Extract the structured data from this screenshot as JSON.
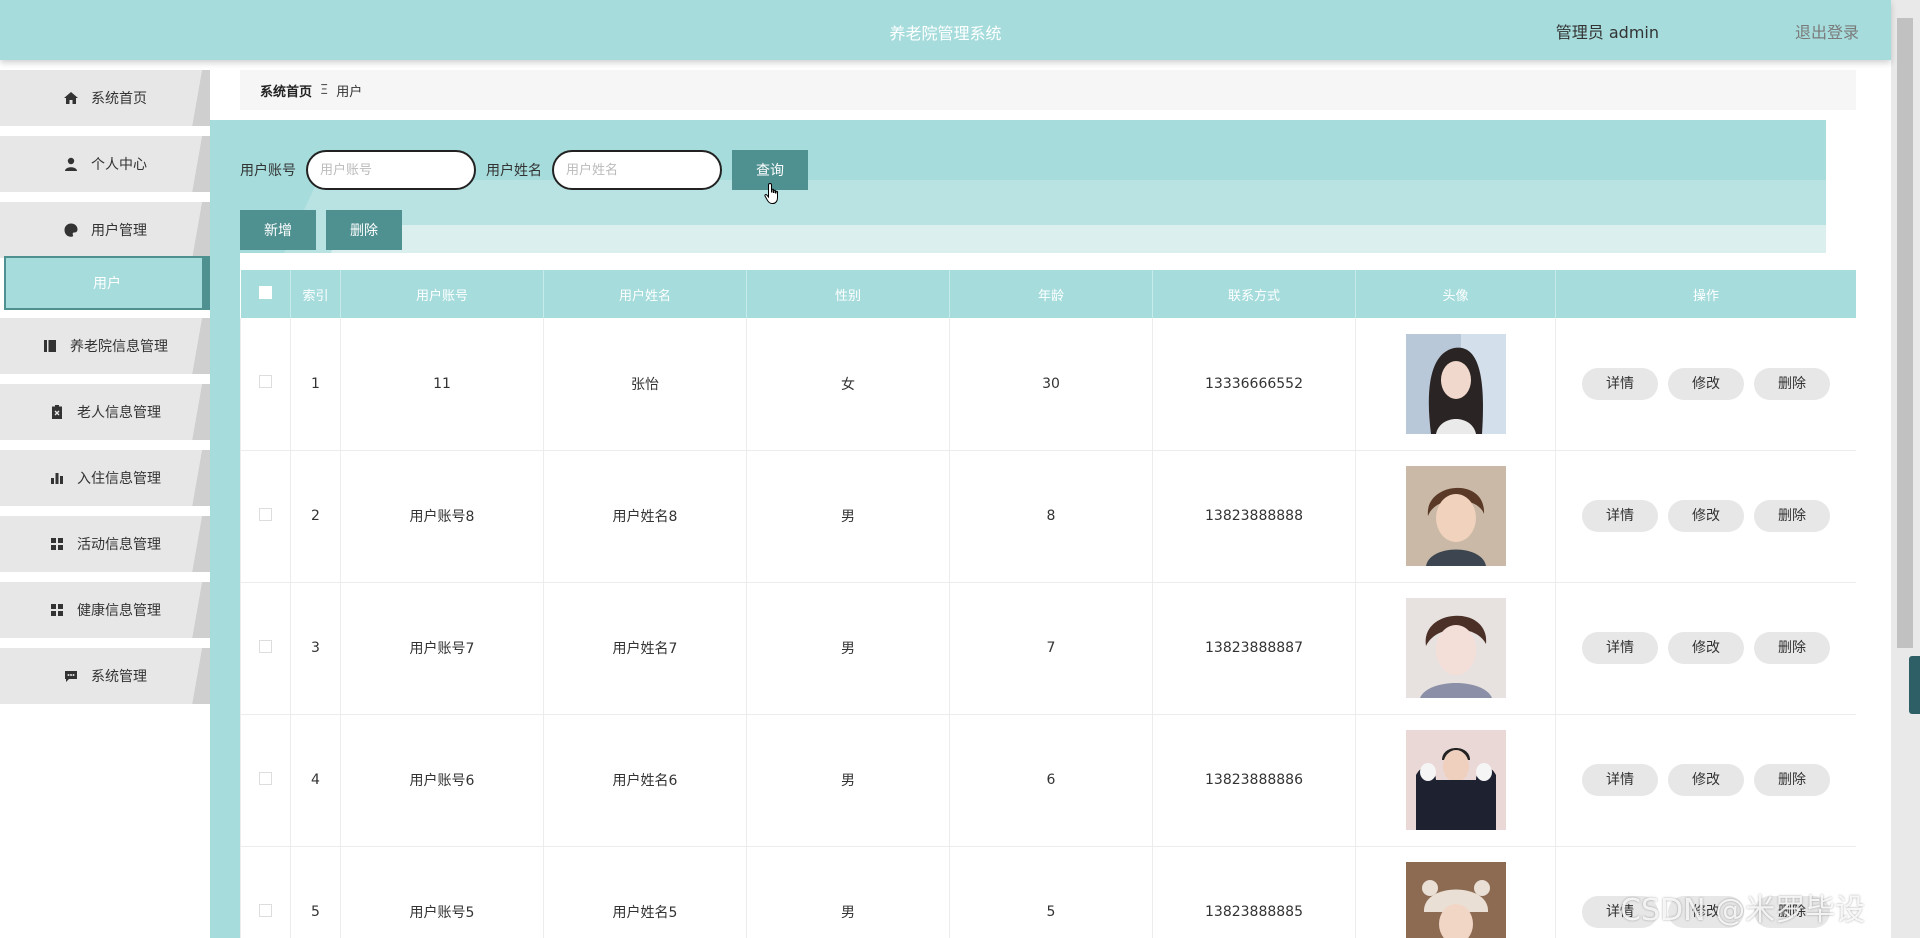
{
  "header": {
    "title": "养老院管理系统",
    "user": "管理员 admin",
    "logout": "退出登录"
  },
  "sidebar": {
    "items": [
      {
        "label": "系统首页",
        "icon": "home-icon"
      },
      {
        "label": "个人中心",
        "icon": "person-icon"
      },
      {
        "label": "用户管理",
        "icon": "palette-icon"
      },
      {
        "label": "养老院信息管理",
        "icon": "book-icon"
      },
      {
        "label": "老人信息管理",
        "icon": "clipboard-icon"
      },
      {
        "label": "入住信息管理",
        "icon": "bar-chart-icon"
      },
      {
        "label": "活动信息管理",
        "icon": "grid-icon"
      },
      {
        "label": "健康信息管理",
        "icon": "grid-icon"
      },
      {
        "label": "系统管理",
        "icon": "chat-icon"
      }
    ],
    "submenu": {
      "label": "用户"
    }
  },
  "breadcrumb": {
    "home": "系统首页",
    "sep": "Ξ",
    "current": "用户"
  },
  "search": {
    "account_label": "用户账号",
    "account_placeholder": "用户账号",
    "name_label": "用户姓名",
    "name_placeholder": "用户姓名",
    "query_label": "查询"
  },
  "actions": {
    "add_label": "新增",
    "delete_label": "删除"
  },
  "table": {
    "columns": [
      "索引",
      "用户账号",
      "用户姓名",
      "性别",
      "年龄",
      "联系方式",
      "头像",
      "操作"
    ],
    "rows": [
      {
        "index": "1",
        "account": "11",
        "name": "张怡",
        "gender": "女",
        "age": "30",
        "phone": "13336666552"
      },
      {
        "index": "2",
        "account": "用户账号8",
        "name": "用户姓名8",
        "gender": "男",
        "age": "8",
        "phone": "13823888888"
      },
      {
        "index": "3",
        "account": "用户账号7",
        "name": "用户姓名7",
        "gender": "男",
        "age": "7",
        "phone": "13823888887"
      },
      {
        "index": "4",
        "account": "用户账号6",
        "name": "用户姓名6",
        "gender": "男",
        "age": "6",
        "phone": "13823888886"
      },
      {
        "index": "5",
        "account": "用户账号5",
        "name": "用户姓名5",
        "gender": "男",
        "age": "5",
        "phone": "13823888885"
      }
    ],
    "row_actions": {
      "detail": "详情",
      "edit": "修改",
      "delete": "删除"
    }
  },
  "watermark": "CSDN @米罗毕设",
  "colors": {
    "primary": "#a6dcdc",
    "accent": "#4f9090",
    "menu_bg": "#e7e7e7"
  }
}
